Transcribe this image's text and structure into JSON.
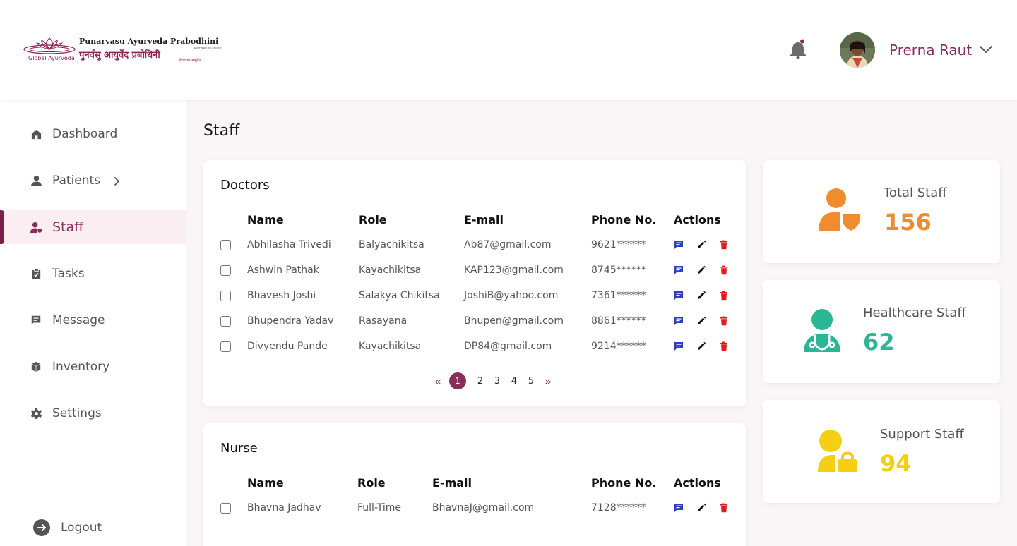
{
  "header": {
    "logo": {
      "name_en": "Punarvasu Ayurveda Prabodhini",
      "tagline": "Ayurveda by choice",
      "name_hi": "पुनर्वसु आयुर्वेद प्रबोधिनी",
      "sub_hi": "विचारांचे आयुर्वेद",
      "brand": "Global Ayurveda"
    },
    "user": {
      "name": "Prerna Raut"
    }
  },
  "sidebar": {
    "items": [
      {
        "label": "Dashboard",
        "icon": "home-icon"
      },
      {
        "label": "Patients",
        "icon": "user-icon"
      },
      {
        "label": "Staff",
        "icon": "staff-icon"
      },
      {
        "label": "Tasks",
        "icon": "clipboard-icon"
      },
      {
        "label": "Message",
        "icon": "message-icon"
      },
      {
        "label": "Inventory",
        "icon": "box-icon"
      },
      {
        "label": "Settings",
        "icon": "gear-icon"
      }
    ],
    "logout": "Logout"
  },
  "page": {
    "title": "Staff"
  },
  "doctors": {
    "title": "Doctors",
    "columns": [
      "Name",
      "Role",
      "E-mail",
      "Phone No.",
      "Actions"
    ],
    "rows": [
      {
        "name": "Abhilasha Trivedi",
        "role": "Balyachikitsa",
        "email": "Ab87@gmail.com",
        "phone": "9621******"
      },
      {
        "name": "Ashwin Pathak",
        "role": "Kayachikitsa",
        "email": "KAP123@gmail.com",
        "phone": "8745******"
      },
      {
        "name": "Bhavesh Joshi",
        "role": "Salakya Chikitsa",
        "email": "JoshiB@yahoo.com",
        "phone": "7361******"
      },
      {
        "name": "Bhupendra Yadav",
        "role": "Rasayana",
        "email": "Bhupen@gmail.com",
        "phone": "8861******"
      },
      {
        "name": "Divyendu Pande",
        "role": "Kayachikitsa",
        "email": "DP84@gmail.com",
        "phone": "9214******"
      }
    ],
    "pagination": {
      "prev": "«",
      "next": "»",
      "pages": [
        "1",
        "2",
        "3",
        "4",
        "5"
      ],
      "current": "1"
    }
  },
  "nurse": {
    "title": "Nurse",
    "columns": [
      "Name",
      "Role",
      "E-mail",
      "Phone No.",
      "Actions"
    ],
    "rows": [
      {
        "name": "Bhavna Jadhav",
        "role": "Full-Time",
        "email": "BhavnaJ@gmail.com",
        "phone": "7128******"
      }
    ]
  },
  "stats": [
    {
      "label": "Total Staff",
      "value": "156",
      "color": "#f08c2c",
      "icon": "staff-shield-icon"
    },
    {
      "label": "Healthcare Staff",
      "value": "62",
      "color": "#2bb795",
      "icon": "doctor-stethoscope-icon"
    },
    {
      "label": "Support Staff",
      "value": "94",
      "color": "#f5cf13",
      "icon": "user-lock-icon"
    }
  ],
  "colors": {
    "accent": "#8b2d5a",
    "active_bg": "#fbeef3",
    "message_icon": "#2f3fc4",
    "delete_icon": "#e31b1b"
  }
}
